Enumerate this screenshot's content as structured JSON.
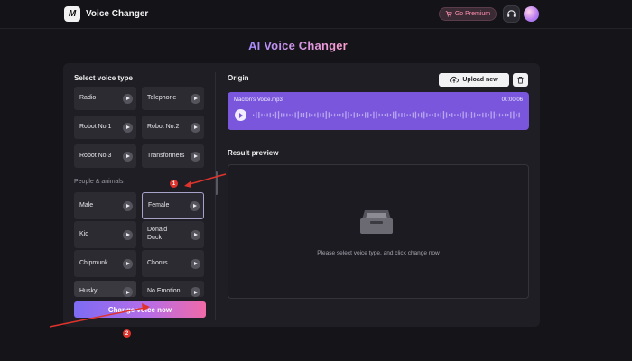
{
  "app": {
    "logo_text": "M",
    "title": "Voice Changer"
  },
  "header": {
    "premium_label": "Go Premium",
    "accent": "#ff8fb0"
  },
  "page_title": "AI Voice Changer",
  "voice_types": {
    "title": "Select voice type",
    "basic": [
      {
        "label": "Radio"
      },
      {
        "label": "Telephone"
      },
      {
        "label": "Robot No.1"
      },
      {
        "label": "Robot No.2"
      },
      {
        "label": "Robot No.3"
      },
      {
        "label": "Transformers"
      }
    ],
    "people_label": "People & animals",
    "people": [
      {
        "label": "Male"
      },
      {
        "label": "Female",
        "selected": true
      },
      {
        "label": "Kid"
      },
      {
        "label": "Donald\nDuck"
      },
      {
        "label": "Chipmunk"
      },
      {
        "label": "Chorus"
      },
      {
        "label": "Husky"
      },
      {
        "label": "No Emotion"
      }
    ],
    "change_button": "Change voice now"
  },
  "origin": {
    "title": "Origin",
    "upload_label": "Upload new",
    "file_name": "Macron's Voice.mp3",
    "duration": "00:00:06",
    "wave_color": "#7a56dd"
  },
  "result": {
    "title": "Result preview",
    "empty_message": "Please select voice type, and click change now"
  },
  "annotations": {
    "marker_1": "1",
    "marker_2": "2",
    "color": "#e0332c"
  }
}
